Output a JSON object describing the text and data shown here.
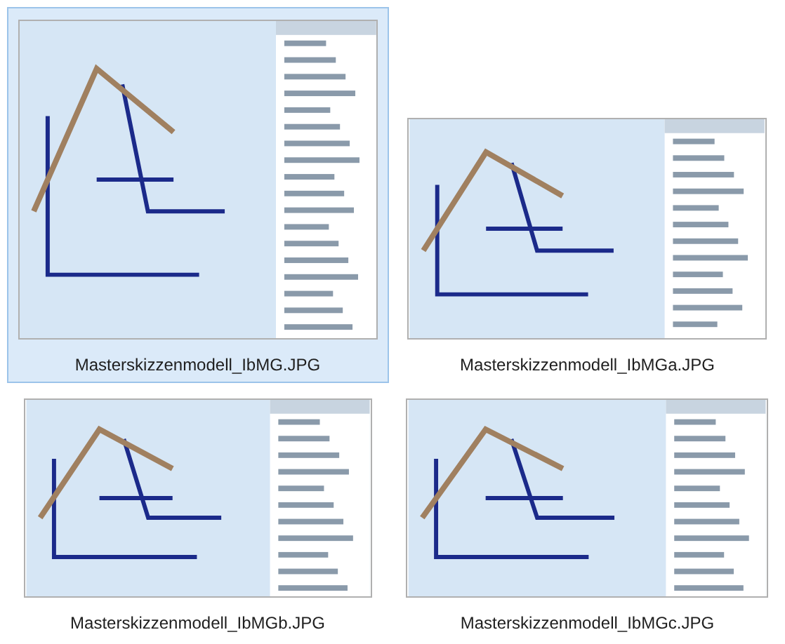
{
  "files": [
    {
      "name": "Masterskizzenmodell_IbMG.JPG",
      "selected": true
    },
    {
      "name": "Masterskizzenmodell_IbMGa.JPG",
      "selected": false
    },
    {
      "name": "Masterskizzenmodell_IbMGb.JPG",
      "selected": false
    },
    {
      "name": "Masterskizzenmodell_IbMGc.JPG",
      "selected": false
    }
  ]
}
